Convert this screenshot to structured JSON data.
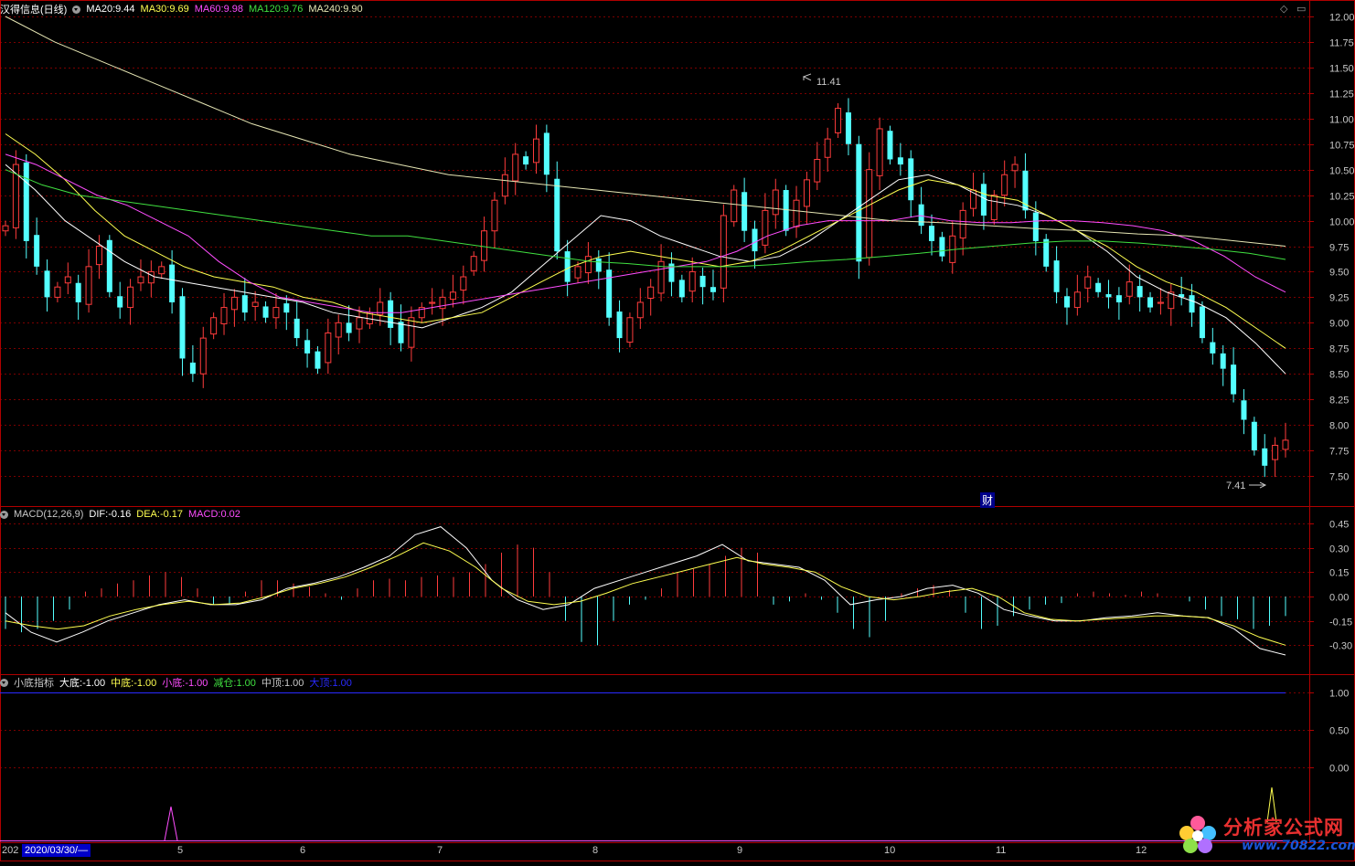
{
  "stock": {
    "name": "汉得信息",
    "period": "(日线)"
  },
  "ma_legend": [
    {
      "label": "MA20:",
      "value": "9.44",
      "color": "#ffffff"
    },
    {
      "label": "MA30:",
      "value": "9.69",
      "color": "#ffff50"
    },
    {
      "label": "MA60:",
      "value": "9.98",
      "color": "#ff4dff"
    },
    {
      "label": "MA120:",
      "value": "9.76",
      "color": "#40e040"
    },
    {
      "label": "MA240:",
      "value": "9.90",
      "color": "#e6e6b4"
    }
  ],
  "macd_legend": {
    "name": "MACD(12,26,9)",
    "items": [
      {
        "label": "DIF:",
        "value": "-0.16",
        "color": "#ffffff"
      },
      {
        "label": "DEA:",
        "value": "-0.17",
        "color": "#ffff50"
      },
      {
        "label": "MACD:",
        "value": "0.02",
        "color": "#ff4dff"
      }
    ]
  },
  "ind_legend": {
    "name": "小底指标",
    "items": [
      {
        "label": "大底:",
        "value": "-1.00",
        "color": "#ffffff"
      },
      {
        "label": "中底:",
        "value": "-1.00",
        "color": "#ffff50"
      },
      {
        "label": "小底:",
        "value": "-1.00",
        "color": "#ff4dff"
      },
      {
        "label": "减仓:",
        "value": "1.00",
        "color": "#40e040"
      },
      {
        "label": "中顶:",
        "value": "1.00",
        "color": "#c8c8c8"
      },
      {
        "label": "大顶:",
        "value": "1.00",
        "color": "#2a2aff"
      }
    ]
  },
  "controls": {
    "diamond": "◇",
    "menu": "▭"
  },
  "annotations": {
    "high_label": "11.41",
    "low_label": "7.41",
    "cai": "财"
  },
  "date_bar": {
    "prefix": "202",
    "selected": "2020/03/30/—",
    "months": [
      "5",
      "6",
      "7",
      "8",
      "9",
      "10",
      "11",
      "12"
    ]
  },
  "watermark": {
    "text": "分析家公式网",
    "url": "www.70822.com"
  },
  "colors": {
    "up": "#ff3c3c",
    "down": "#54ffff",
    "grid": "#7a0000",
    "border": "#b00000"
  },
  "chart_data": [
    {
      "type": "candlestick",
      "title": "汉得信息(日线)",
      "ylim": [
        7.3,
        12.1
      ],
      "y_ticks": [
        7.5,
        7.75,
        8.0,
        8.25,
        8.5,
        8.75,
        9.0,
        9.25,
        9.5,
        9.75,
        10.0,
        10.25,
        10.5,
        10.75,
        11.0,
        11.25,
        11.5,
        11.75,
        12.0
      ],
      "y_tick_labels": [
        "7.50",
        "7.75",
        "8.00",
        "8.25",
        "8.50",
        "8.75",
        "9.00",
        "9.25",
        "9.50",
        "9.75",
        "10.00",
        "10.25",
        "10.50",
        "10.75",
        "11.00",
        "11.25",
        "11.50",
        "11.75",
        "12.00"
      ],
      "x_months": [
        "5",
        "6",
        "7",
        "8",
        "9",
        "10",
        "11",
        "12"
      ],
      "closes": [
        9.95,
        10.55,
        9.8,
        9.55,
        9.25,
        9.35,
        9.45,
        9.2,
        9.55,
        9.75,
        9.3,
        9.15,
        9.35,
        9.45,
        9.5,
        9.55,
        9.2,
        8.65,
        8.5,
        8.85,
        9.05,
        9.15,
        9.25,
        9.1,
        9.2,
        9.05,
        9.15,
        9.1,
        8.85,
        8.7,
        8.55,
        8.9,
        9.0,
        8.9,
        9.05,
        9.1,
        9.2,
        8.95,
        8.8,
        9.05,
        9.15,
        9.2,
        9.25,
        9.3,
        9.45,
        9.65,
        9.9,
        10.2,
        10.45,
        10.65,
        10.55,
        10.8,
        10.45,
        9.7,
        9.4,
        9.55,
        9.65,
        9.5,
        9.05,
        8.85,
        9.05,
        9.2,
        9.35,
        9.6,
        9.4,
        9.25,
        9.5,
        9.35,
        9.3,
        10.05,
        10.3,
        9.9,
        9.7,
        10.1,
        10.3,
        9.9,
        10.2,
        10.4,
        10.6,
        10.8,
        11.1,
        10.75,
        9.6,
        10.5,
        10.9,
        10.6,
        10.55,
        10.2,
        9.95,
        9.8,
        9.65,
        9.85,
        10.1,
        10.3,
        10.05,
        10.25,
        10.45,
        10.55,
        10.1,
        9.8,
        9.55,
        9.3,
        9.15,
        9.3,
        9.45,
        9.3,
        9.25,
        9.2,
        9.4,
        9.25,
        9.15,
        9.2,
        9.3,
        9.25,
        9.1,
        8.85,
        8.7,
        8.55,
        8.3,
        8.05,
        7.75,
        7.6,
        7.8,
        7.85
      ],
      "series": [
        {
          "name": "MA20",
          "values": [
            10.55,
            10.3,
            10.0,
            9.8,
            9.6,
            9.45,
            9.4,
            9.35,
            9.3,
            9.25,
            9.2,
            9.1,
            9.05,
            9.0,
            8.95,
            9.05,
            9.15,
            9.3,
            9.55,
            9.8,
            10.05,
            10.0,
            9.85,
            9.75,
            9.65,
            9.6,
            9.65,
            9.8,
            10.0,
            10.2,
            10.4,
            10.45,
            10.35,
            10.2,
            10.15,
            10.05,
            9.9,
            9.7,
            9.45,
            9.3,
            9.2,
            9.05,
            8.8,
            8.5
          ],
          "color": "#ffffff"
        },
        {
          "name": "MA30",
          "values": [
            10.85,
            10.65,
            10.4,
            10.1,
            9.85,
            9.7,
            9.55,
            9.45,
            9.4,
            9.35,
            9.25,
            9.2,
            9.1,
            9.05,
            9.0,
            9.05,
            9.1,
            9.25,
            9.4,
            9.55,
            9.65,
            9.7,
            9.65,
            9.6,
            9.55,
            9.6,
            9.7,
            9.85,
            10.0,
            10.15,
            10.3,
            10.4,
            10.35,
            10.25,
            10.2,
            10.05,
            9.9,
            9.75,
            9.55,
            9.4,
            9.3,
            9.15,
            8.95,
            8.75
          ],
          "color": "#ffff50"
        },
        {
          "name": "MA60",
          "values": [
            10.65,
            10.55,
            10.4,
            10.25,
            10.15,
            10.0,
            9.85,
            9.6,
            9.4,
            9.25,
            9.2,
            9.15,
            9.1,
            9.1,
            9.15,
            9.2,
            9.25,
            9.3,
            9.35,
            9.4,
            9.45,
            9.5,
            9.55,
            9.6,
            9.7,
            9.85,
            9.95,
            10.0,
            10.0,
            10.0,
            10.05,
            10.0,
            9.98,
            9.98,
            10.0,
            10.0,
            9.98,
            9.95,
            9.9,
            9.8,
            9.65,
            9.45,
            9.3
          ],
          "color": "#ff4dff"
        },
        {
          "name": "MA120",
          "values": [
            10.5,
            10.35,
            10.25,
            10.2,
            10.15,
            10.1,
            10.05,
            10.0,
            9.95,
            9.9,
            9.85,
            9.85,
            9.8,
            9.75,
            9.7,
            9.65,
            9.6,
            9.58,
            9.55,
            9.55,
            9.55,
            9.57,
            9.6,
            9.62,
            9.65,
            9.68,
            9.72,
            9.75,
            9.78,
            9.8,
            9.8,
            9.78,
            9.75,
            9.72,
            9.68,
            9.62
          ],
          "color": "#40e040"
        },
        {
          "name": "MA240",
          "values": [
            12.0,
            11.75,
            11.55,
            11.35,
            11.15,
            10.95,
            10.8,
            10.65,
            10.55,
            10.45,
            10.4,
            10.35,
            10.3,
            10.25,
            10.2,
            10.15,
            10.1,
            10.05,
            10.0,
            9.98,
            9.95,
            9.92,
            9.9,
            9.87,
            9.85,
            9.8,
            9.75
          ],
          "color": "#e6e6b4"
        }
      ]
    },
    {
      "type": "bar",
      "title": "MACD(12,26,9)",
      "ylim": [
        -0.42,
        0.52
      ],
      "y_ticks": [
        0.45,
        0.3,
        0.15,
        0.0,
        -0.15,
        -0.3
      ],
      "y_tick_labels": [
        "0.45",
        "0.30",
        "0.15",
        "0.00",
        "-0.15",
        "-0.30"
      ],
      "values": [
        -0.2,
        -0.22,
        -0.2,
        -0.15,
        -0.08,
        0.03,
        0.05,
        0.08,
        0.1,
        0.13,
        0.15,
        0.12,
        0.05,
        -0.05,
        -0.05,
        0.03,
        0.1,
        0.1,
        0.08,
        0.06,
        0.02,
        -0.02,
        0.05,
        0.1,
        0.11,
        0.1,
        0.12,
        0.13,
        0.12,
        0.15,
        0.2,
        0.27,
        0.32,
        0.3,
        0.15,
        -0.15,
        -0.28,
        -0.3,
        -0.15,
        -0.05,
        -0.02,
        0.05,
        0.15,
        0.17,
        0.2,
        0.25,
        0.3,
        0.27,
        -0.05,
        -0.03,
        0.02,
        -0.02,
        -0.1,
        -0.2,
        -0.25,
        -0.15,
        0.02,
        0.05,
        0.07,
        0.04,
        -0.1,
        -0.2,
        -0.18,
        -0.12,
        -0.08,
        -0.05,
        -0.04,
        0.02,
        0.03,
        0.02,
        0.01,
        0.03,
        0.02,
        0.0,
        -0.03,
        -0.08,
        -0.12,
        -0.14,
        -0.2,
        -0.18,
        -0.12
      ],
      "series": [
        {
          "name": "DIF",
          "values": [
            -0.1,
            -0.22,
            -0.28,
            -0.22,
            -0.15,
            -0.1,
            -0.05,
            -0.02,
            -0.05,
            -0.05,
            -0.02,
            0.05,
            0.08,
            0.12,
            0.18,
            0.25,
            0.38,
            0.43,
            0.3,
            0.1,
            -0.02,
            -0.08,
            -0.05,
            0.05,
            0.1,
            0.15,
            0.2,
            0.25,
            0.32,
            0.22,
            0.2,
            0.18,
            0.1,
            -0.05,
            -0.02,
            0.0,
            0.05,
            0.07,
            0.02,
            -0.08,
            -0.12,
            -0.15,
            -0.15,
            -0.13,
            -0.12,
            -0.1,
            -0.12,
            -0.13,
            -0.2,
            -0.32,
            -0.36
          ],
          "color": "#ffffff"
        },
        {
          "name": "DEA",
          "values": [
            -0.15,
            -0.18,
            -0.2,
            -0.18,
            -0.12,
            -0.08,
            -0.05,
            -0.03,
            -0.05,
            -0.04,
            0.0,
            0.05,
            0.08,
            0.12,
            0.18,
            0.25,
            0.33,
            0.28,
            0.18,
            0.05,
            -0.03,
            -0.05,
            -0.03,
            0.02,
            0.08,
            0.12,
            0.16,
            0.2,
            0.24,
            0.2,
            0.18,
            0.15,
            0.06,
            0.0,
            -0.02,
            0.0,
            0.03,
            0.05,
            0.0,
            -0.1,
            -0.14,
            -0.15,
            -0.14,
            -0.13,
            -0.12,
            -0.12,
            -0.13,
            -0.18,
            -0.25,
            -0.3
          ],
          "color": "#ffff50"
        }
      ]
    },
    {
      "type": "line",
      "title": "小底指标",
      "ylim": [
        -0.48,
        1.12
      ],
      "y_ticks": [
        1.0,
        0.5,
        0.0
      ],
      "y_tick_labels": [
        "1.00",
        "0.50",
        "0.00"
      ]
    }
  ]
}
